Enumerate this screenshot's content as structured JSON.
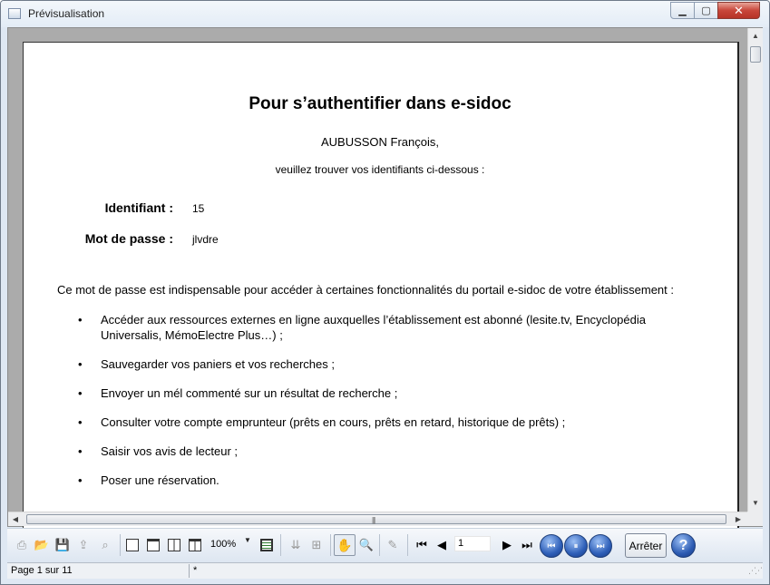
{
  "window": {
    "title": "Prévisualisation"
  },
  "document": {
    "title": "Pour s’authentifier dans e-sidoc",
    "name": "AUBUSSON François,",
    "intro": "veuillez trouver vos identifiants ci-dessous :",
    "login_label": "Identifiant :",
    "login_value": "15",
    "password_label": "Mot de passe :",
    "password_value": "jlvdre",
    "paragraph": "Ce mot de passe est indispensable pour accéder à certaines fonctionnalités du portail e-sidoc de votre établissement :",
    "bullets": [
      "Accéder aux ressources externes en ligne auxquelles l’établissement est abonné (lesite.tv, Encyclopédia Universalis, MémoElectre Plus…) ;",
      "Sauvegarder vos paniers et vos recherches ;",
      "Envoyer un mél commenté sur un résultat de recherche ;",
      "Consulter votre compte emprunteur (prêts en cours, prêts en retard, historique de prêts) ;",
      "Saisir vos avis de lecteur ;",
      "Poser une réservation."
    ],
    "bullet_glyph": "•"
  },
  "toolbar": {
    "zoom_value": "100%",
    "page_value": "1",
    "stop_label": "Arrêter",
    "help_label": "?"
  },
  "status": {
    "page_text": "Page 1 sur 11",
    "modified": "*"
  },
  "colors": {
    "accent_blue": "#2e5fb8",
    "close_red": "#c8463a"
  }
}
